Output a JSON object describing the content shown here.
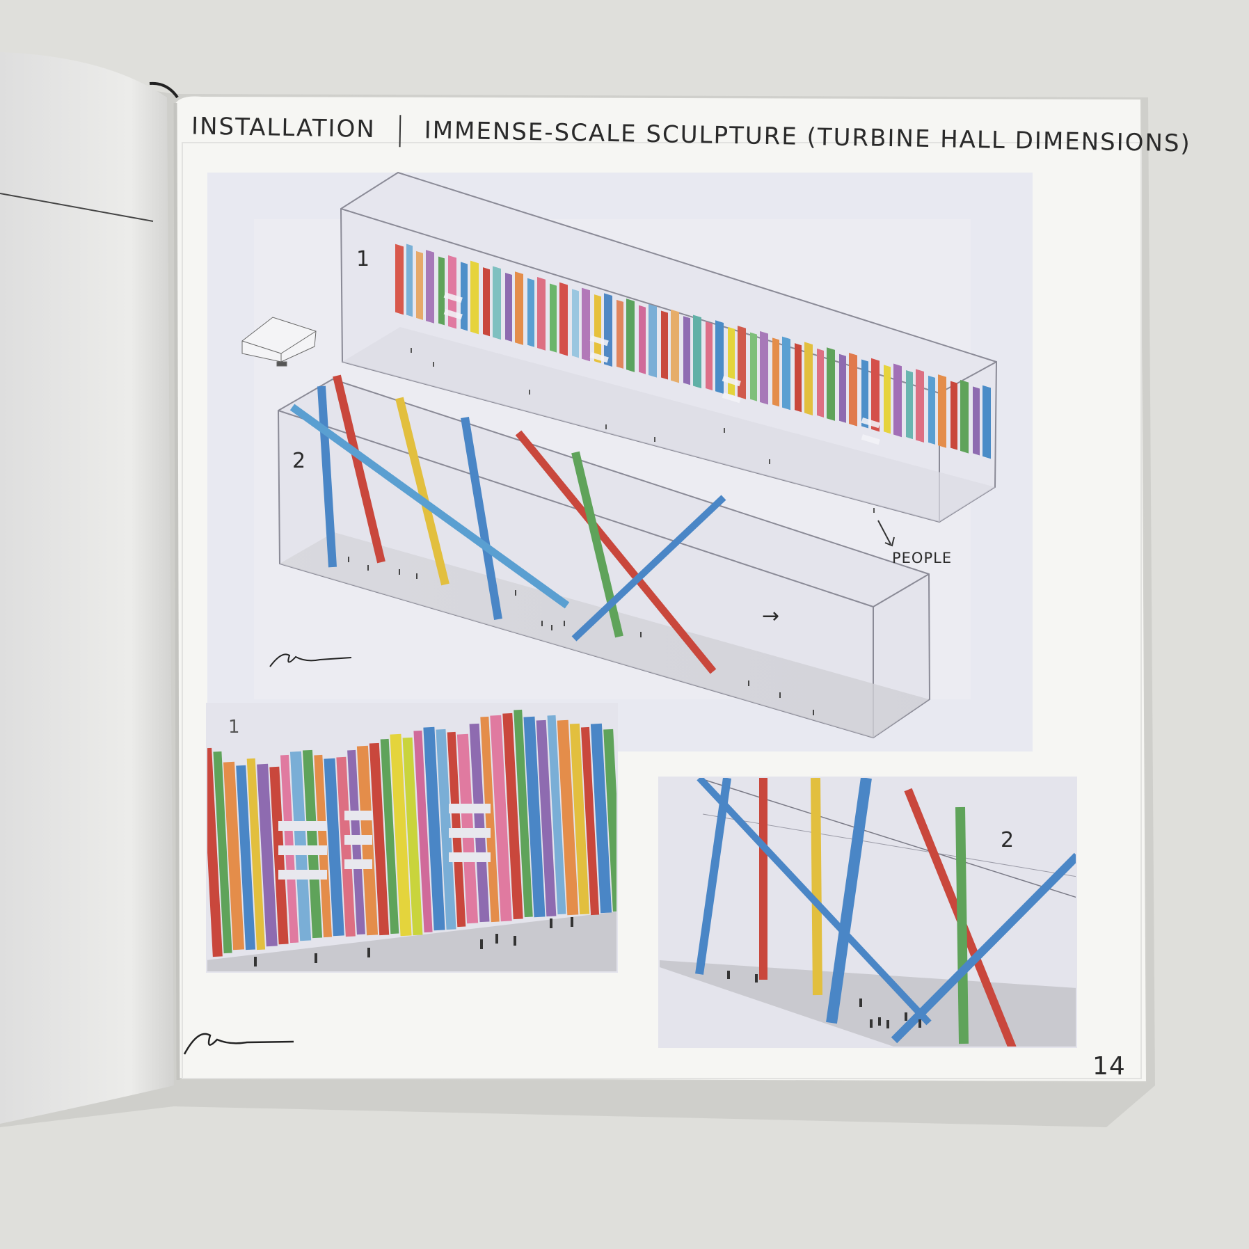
{
  "header": {
    "title_left": "INSTALLATION",
    "title_right": "IMMENSE-SCALE SCULPTURE (TURBINE HALL DIMENSIONS)"
  },
  "main_print": {
    "label_1": "1",
    "label_2": "2",
    "annotation": "PEOPLE",
    "arrow_glyph": "→"
  },
  "photo_left": {
    "label": "1"
  },
  "photo_right": {
    "label": "2"
  },
  "page_number": "14",
  "colors": {
    "desk": "#dfdfdb",
    "page": "#f6f6f3",
    "print_bg": "#e8e9f1",
    "ink": "#2a2a2a"
  }
}
